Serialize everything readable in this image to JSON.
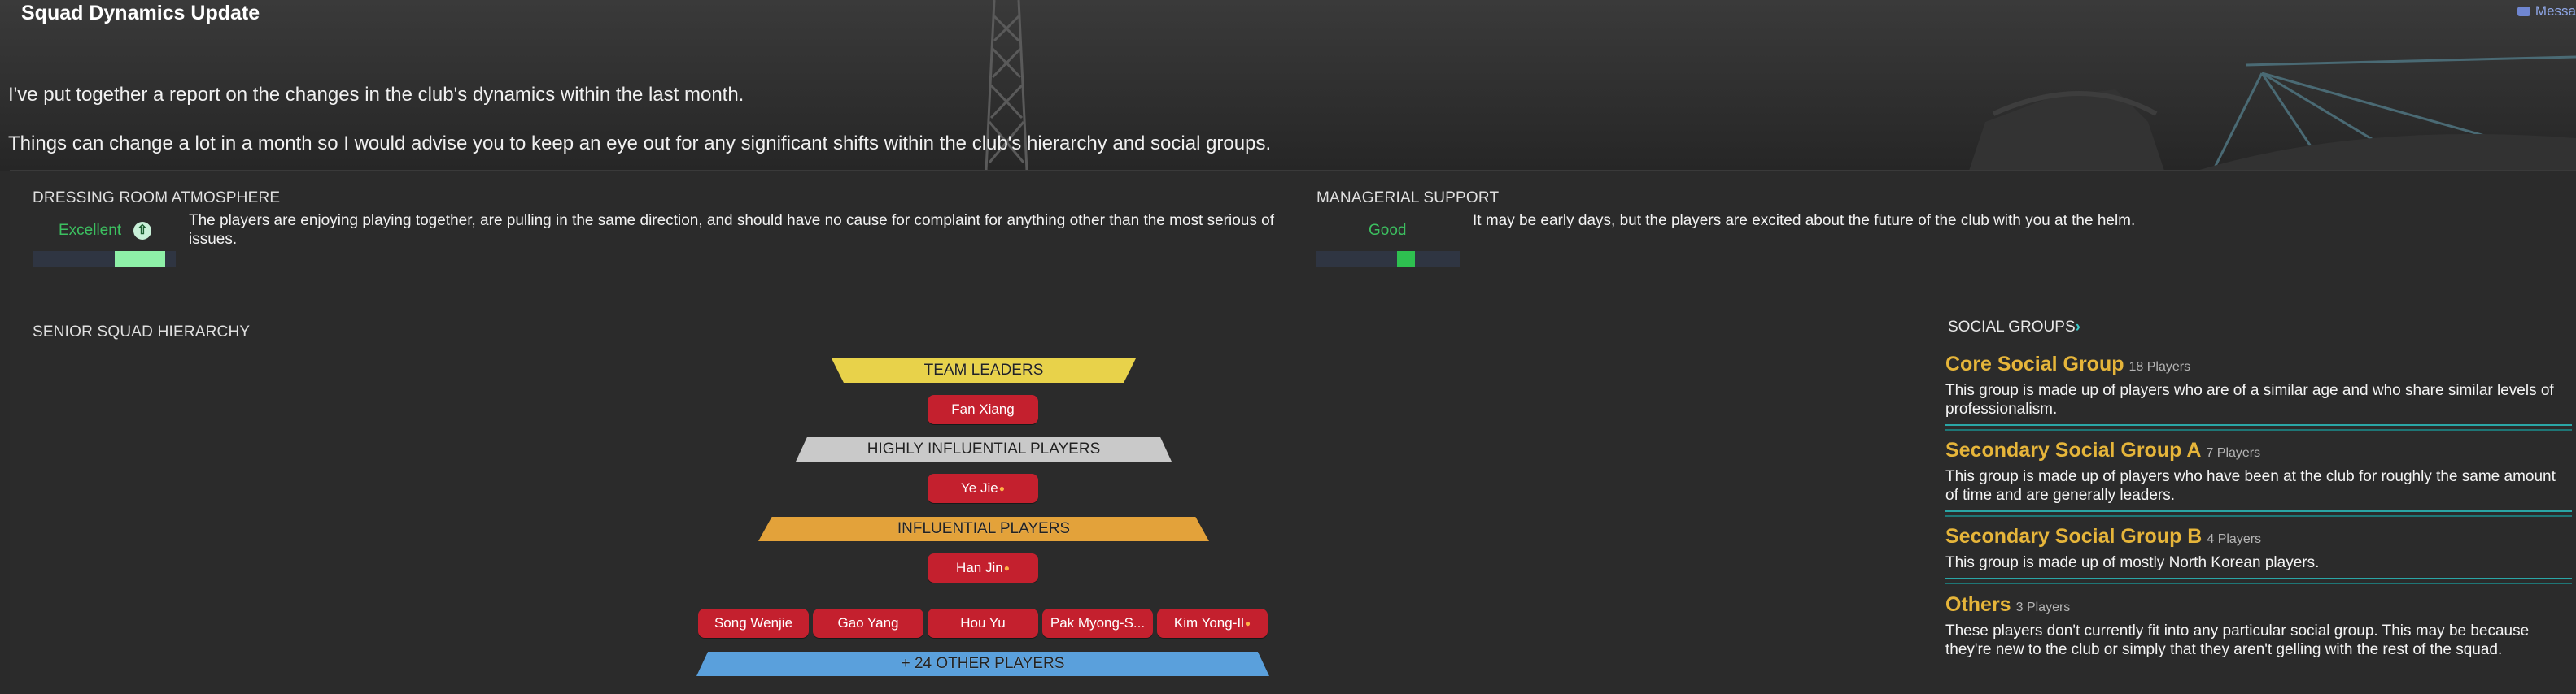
{
  "header": {
    "title": "Squad Dynamics Update",
    "messages_label": "Messa",
    "intro_line1": "I've put together a report on the changes in the club's dynamics within the last month.",
    "intro_line2": "Things can change a lot in a month so I would advise you to keep an eye out for any significant shifts within the club's hierarchy and social groups."
  },
  "atmosphere": {
    "title": "DRESSING ROOM ATMOSPHERE",
    "rating": "Excellent",
    "rating_color": "#3cc060",
    "level": 1.0,
    "description": "The players are enjoying playing together, are pulling in the same direction, and should have no cause for complaint for anything other than the most serious of issues."
  },
  "managerial": {
    "title": "MANAGERIAL SUPPORT",
    "rating": "Good",
    "rating_color": "#3cc060",
    "level": 0.75,
    "description": "It may be early days, but the players are excited about the future of the club with you at the helm."
  },
  "hierarchy": {
    "title": "SENIOR SQUAD HIERARCHY",
    "team_leaders_label": "TEAM LEADERS",
    "team_leaders": [
      "Fan Xiang"
    ],
    "highly_influential_label": "HIGHLY INFLUENTIAL PLAYERS",
    "highly_influential": [
      "Ye Jie"
    ],
    "influential_label": "INFLUENTIAL PLAYERS",
    "influential": [
      "Han Jin"
    ],
    "others": [
      "Song Wenjie",
      "Gao Yang",
      "Hou Yu",
      "Pak Myong-S...",
      "Kim Yong-Il"
    ],
    "other_players_label": "+ 24 OTHER PLAYERS"
  },
  "social_groups": {
    "title": "SOCIAL GROUPS",
    "groups": [
      {
        "name": "Core Social Group",
        "count": "18 Players",
        "description": "This group is made up of players who are of a similar age and who share similar levels of professionalism."
      },
      {
        "name": "Secondary Social Group A",
        "count": "7 Players",
        "description": "This group is made up of players who have been at the club for roughly the same amount of time and are generally leaders."
      },
      {
        "name": "Secondary Social Group B",
        "count": "4 Players",
        "description": "This group is made up of mostly North Korean players."
      },
      {
        "name": "Others",
        "count": "3 Players",
        "description": "These players don't currently fit into any particular social group. This may be because they're new to the club or simply that they aren't gelling with the rest of the squad."
      }
    ]
  }
}
